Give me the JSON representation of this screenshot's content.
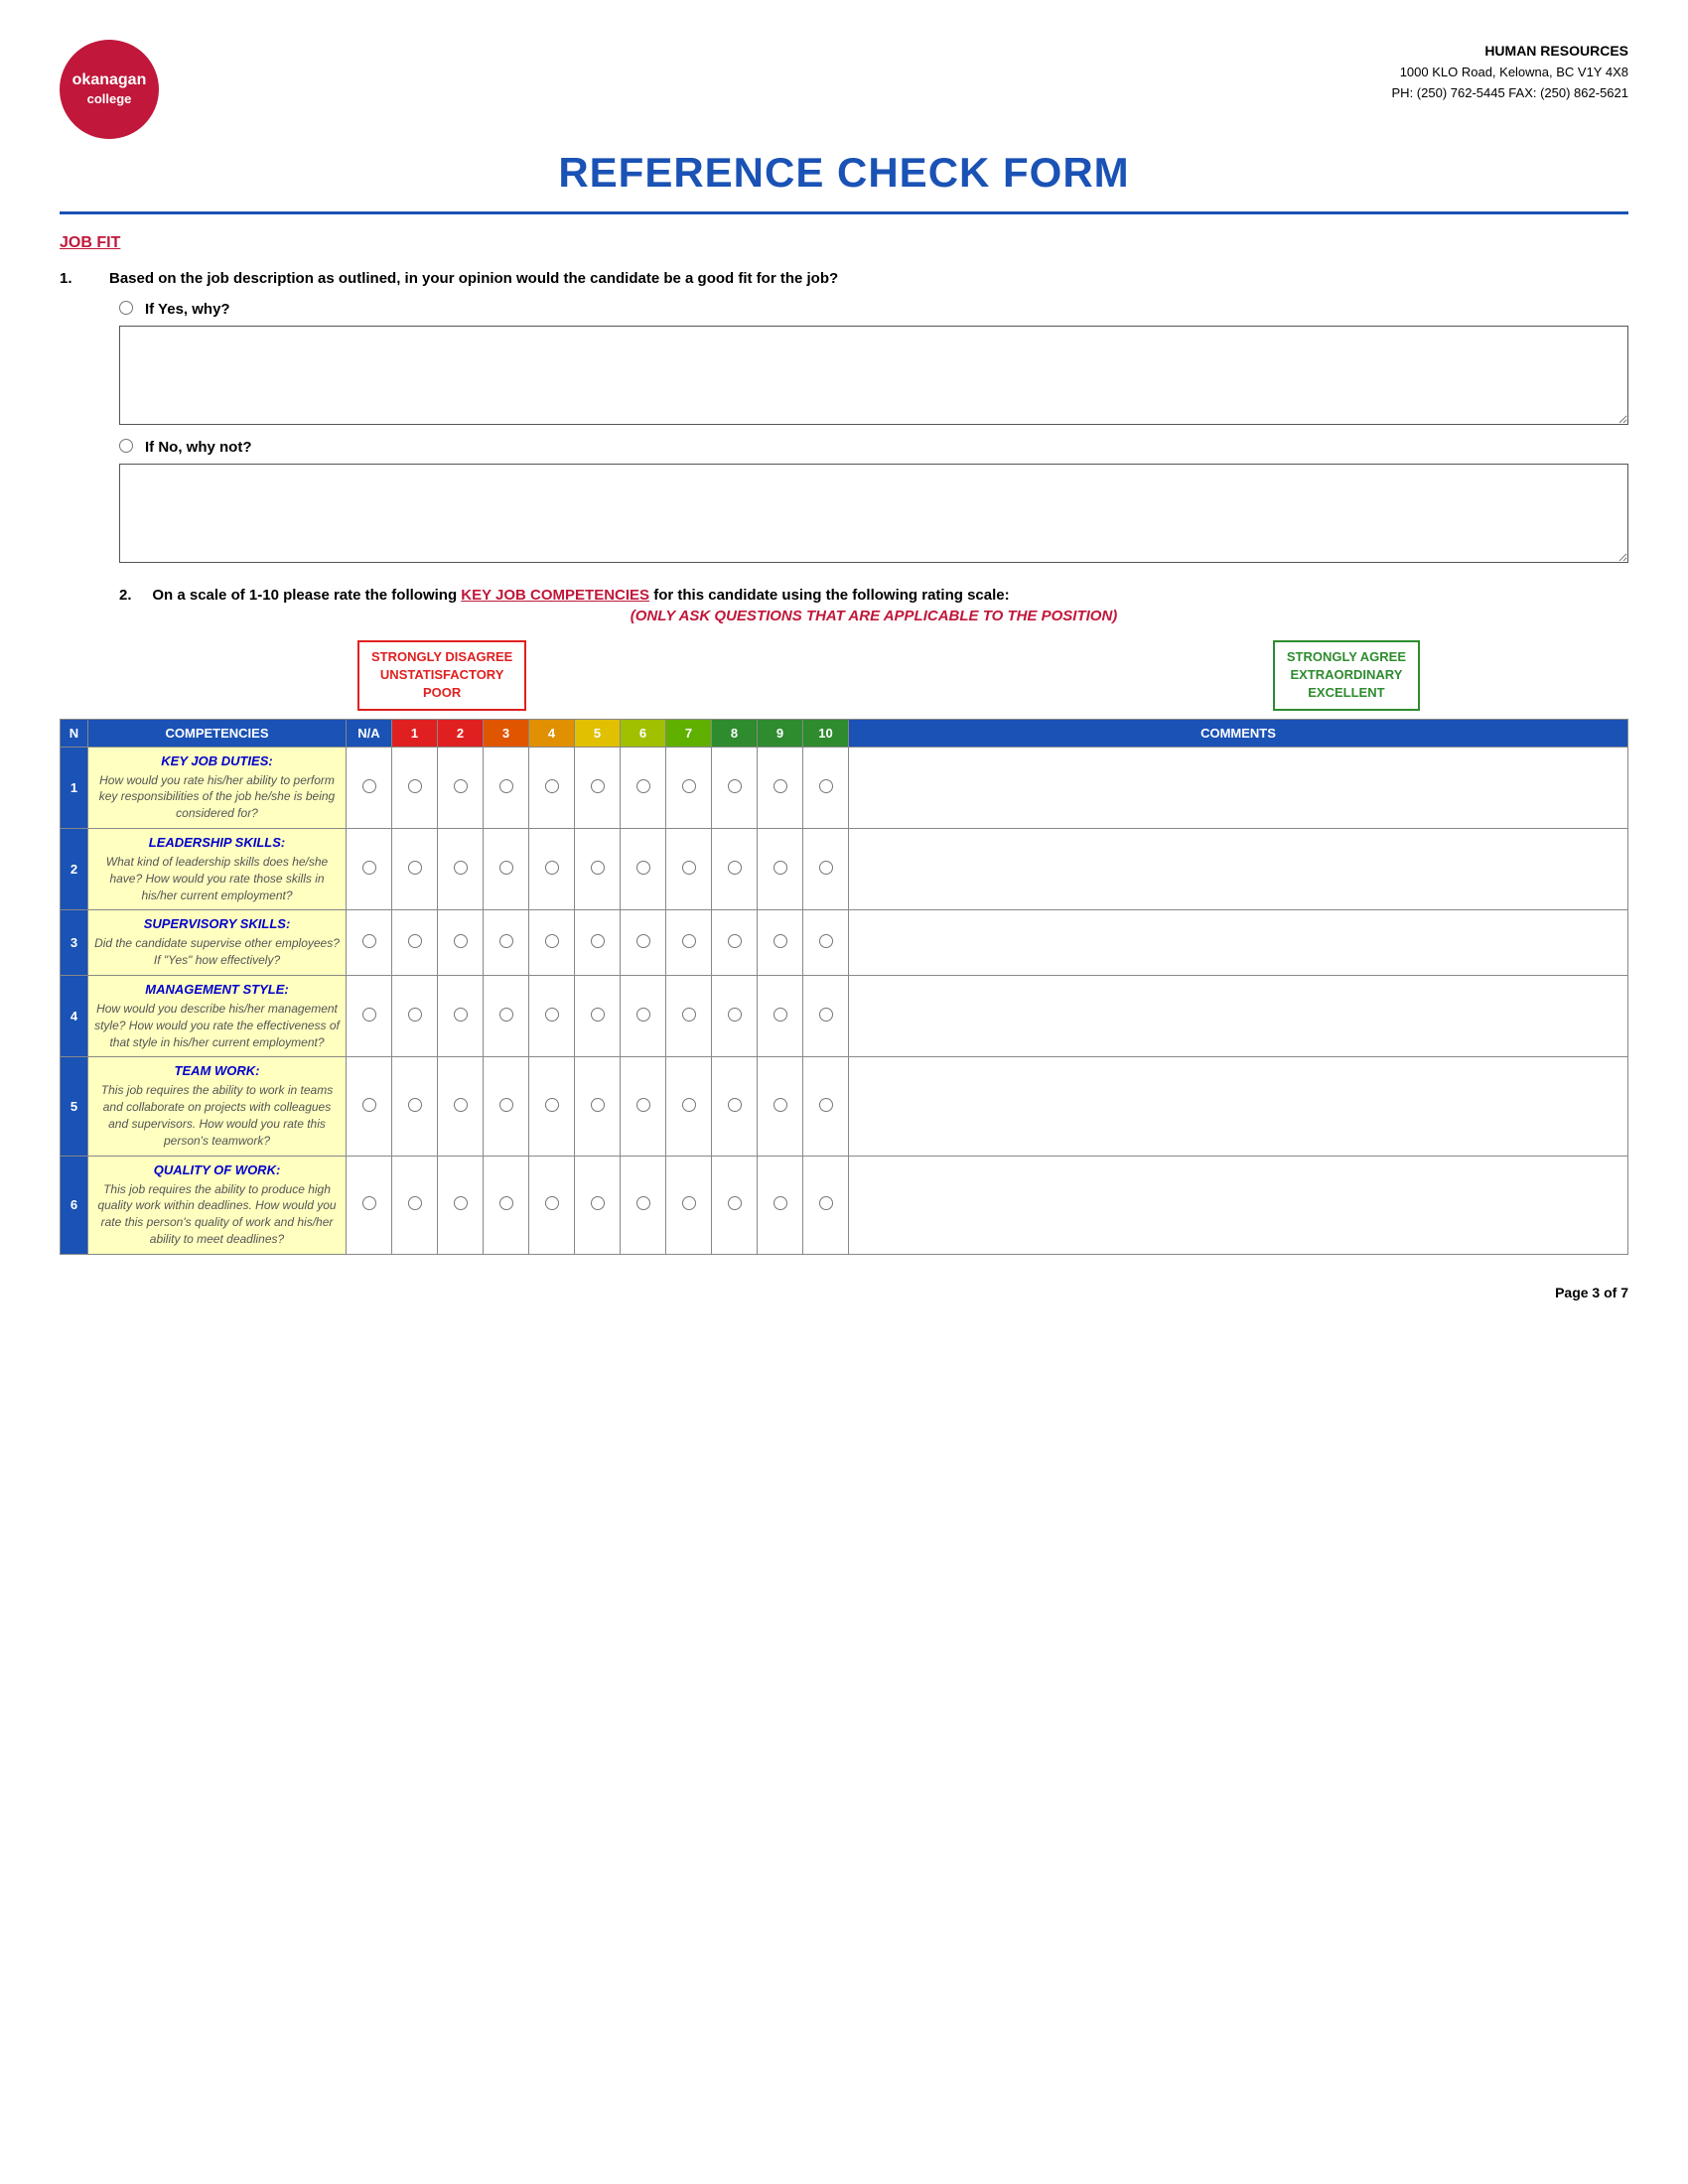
{
  "header": {
    "org_line1": "okanagan",
    "org_line2": "college",
    "dept": "HUMAN RESOURCES",
    "address": "1000 KLO Road, Kelowna, BC V1Y 4X8",
    "phone": "PH: (250) 762-5445 FAX: (250) 862-5621",
    "form_title": "REFERENCE CHECK FORM"
  },
  "section_job_fit": {
    "label": "JOB FIT",
    "q1_text": "Based on the job description as outlined, in your opinion would the candidate be a good fit for the job?",
    "q1_num": "1.",
    "if_yes_label": "If Yes, why?",
    "if_no_label": "If No, why not?"
  },
  "section_competencies": {
    "q2_num": "2.",
    "q2_intro1": "On a scale of 1-10 please rate the following ",
    "q2_key": "KEY JOB COMPETENCIES",
    "q2_intro2": " for this candidate using the following rating scale:",
    "q2_only_ask": "(ONLY ASK QUESTIONS THAT ARE APPLICABLE TO THE POSITION)",
    "scale_low_label": "STRONGLY DISAGREE\nUNSTATISFACTORY\nPOOR",
    "scale_high_label": "STRONGLY AGREE\nEXTRAORDINARY\nEXCELLENT",
    "col_n": "N",
    "col_competencies": "COMPETENCIES",
    "col_na": "N/A",
    "col_comments": "COMMENTS",
    "ratings": [
      "1",
      "2",
      "3",
      "4",
      "5",
      "6",
      "7",
      "8",
      "9",
      "10"
    ],
    "rows": [
      {
        "num": "1",
        "title": "KEY JOB DUTIES:",
        "desc": "How would you rate his/her ability to perform key responsibilities of the job he/she is being considered for?"
      },
      {
        "num": "2",
        "title": "LEADERSHIP SKILLS:",
        "desc": "What kind of leadership skills does he/she have? How would you rate those skills in his/her current employment?"
      },
      {
        "num": "3",
        "title": "SUPERVISORY SKILLS:",
        "desc": "Did the candidate supervise other employees? If \"Yes\" how effectively?"
      },
      {
        "num": "4",
        "title": "MANAGEMENT STYLE:",
        "desc": "How would you describe his/her management style? How would you rate the effectiveness of that style in his/her current employment?"
      },
      {
        "num": "5",
        "title": "TEAM WORK:",
        "desc": "This job requires the ability to work in teams and collaborate on projects with colleagues and supervisors. How would you rate this person's teamwork?"
      },
      {
        "num": "6",
        "title": "QUALITY OF WORK:",
        "desc": "This job requires the ability to produce high quality work within deadlines. How would you rate this person's quality of work and his/her ability to meet deadlines?"
      }
    ]
  },
  "footer": {
    "page_text": "Page 3 of 7"
  }
}
